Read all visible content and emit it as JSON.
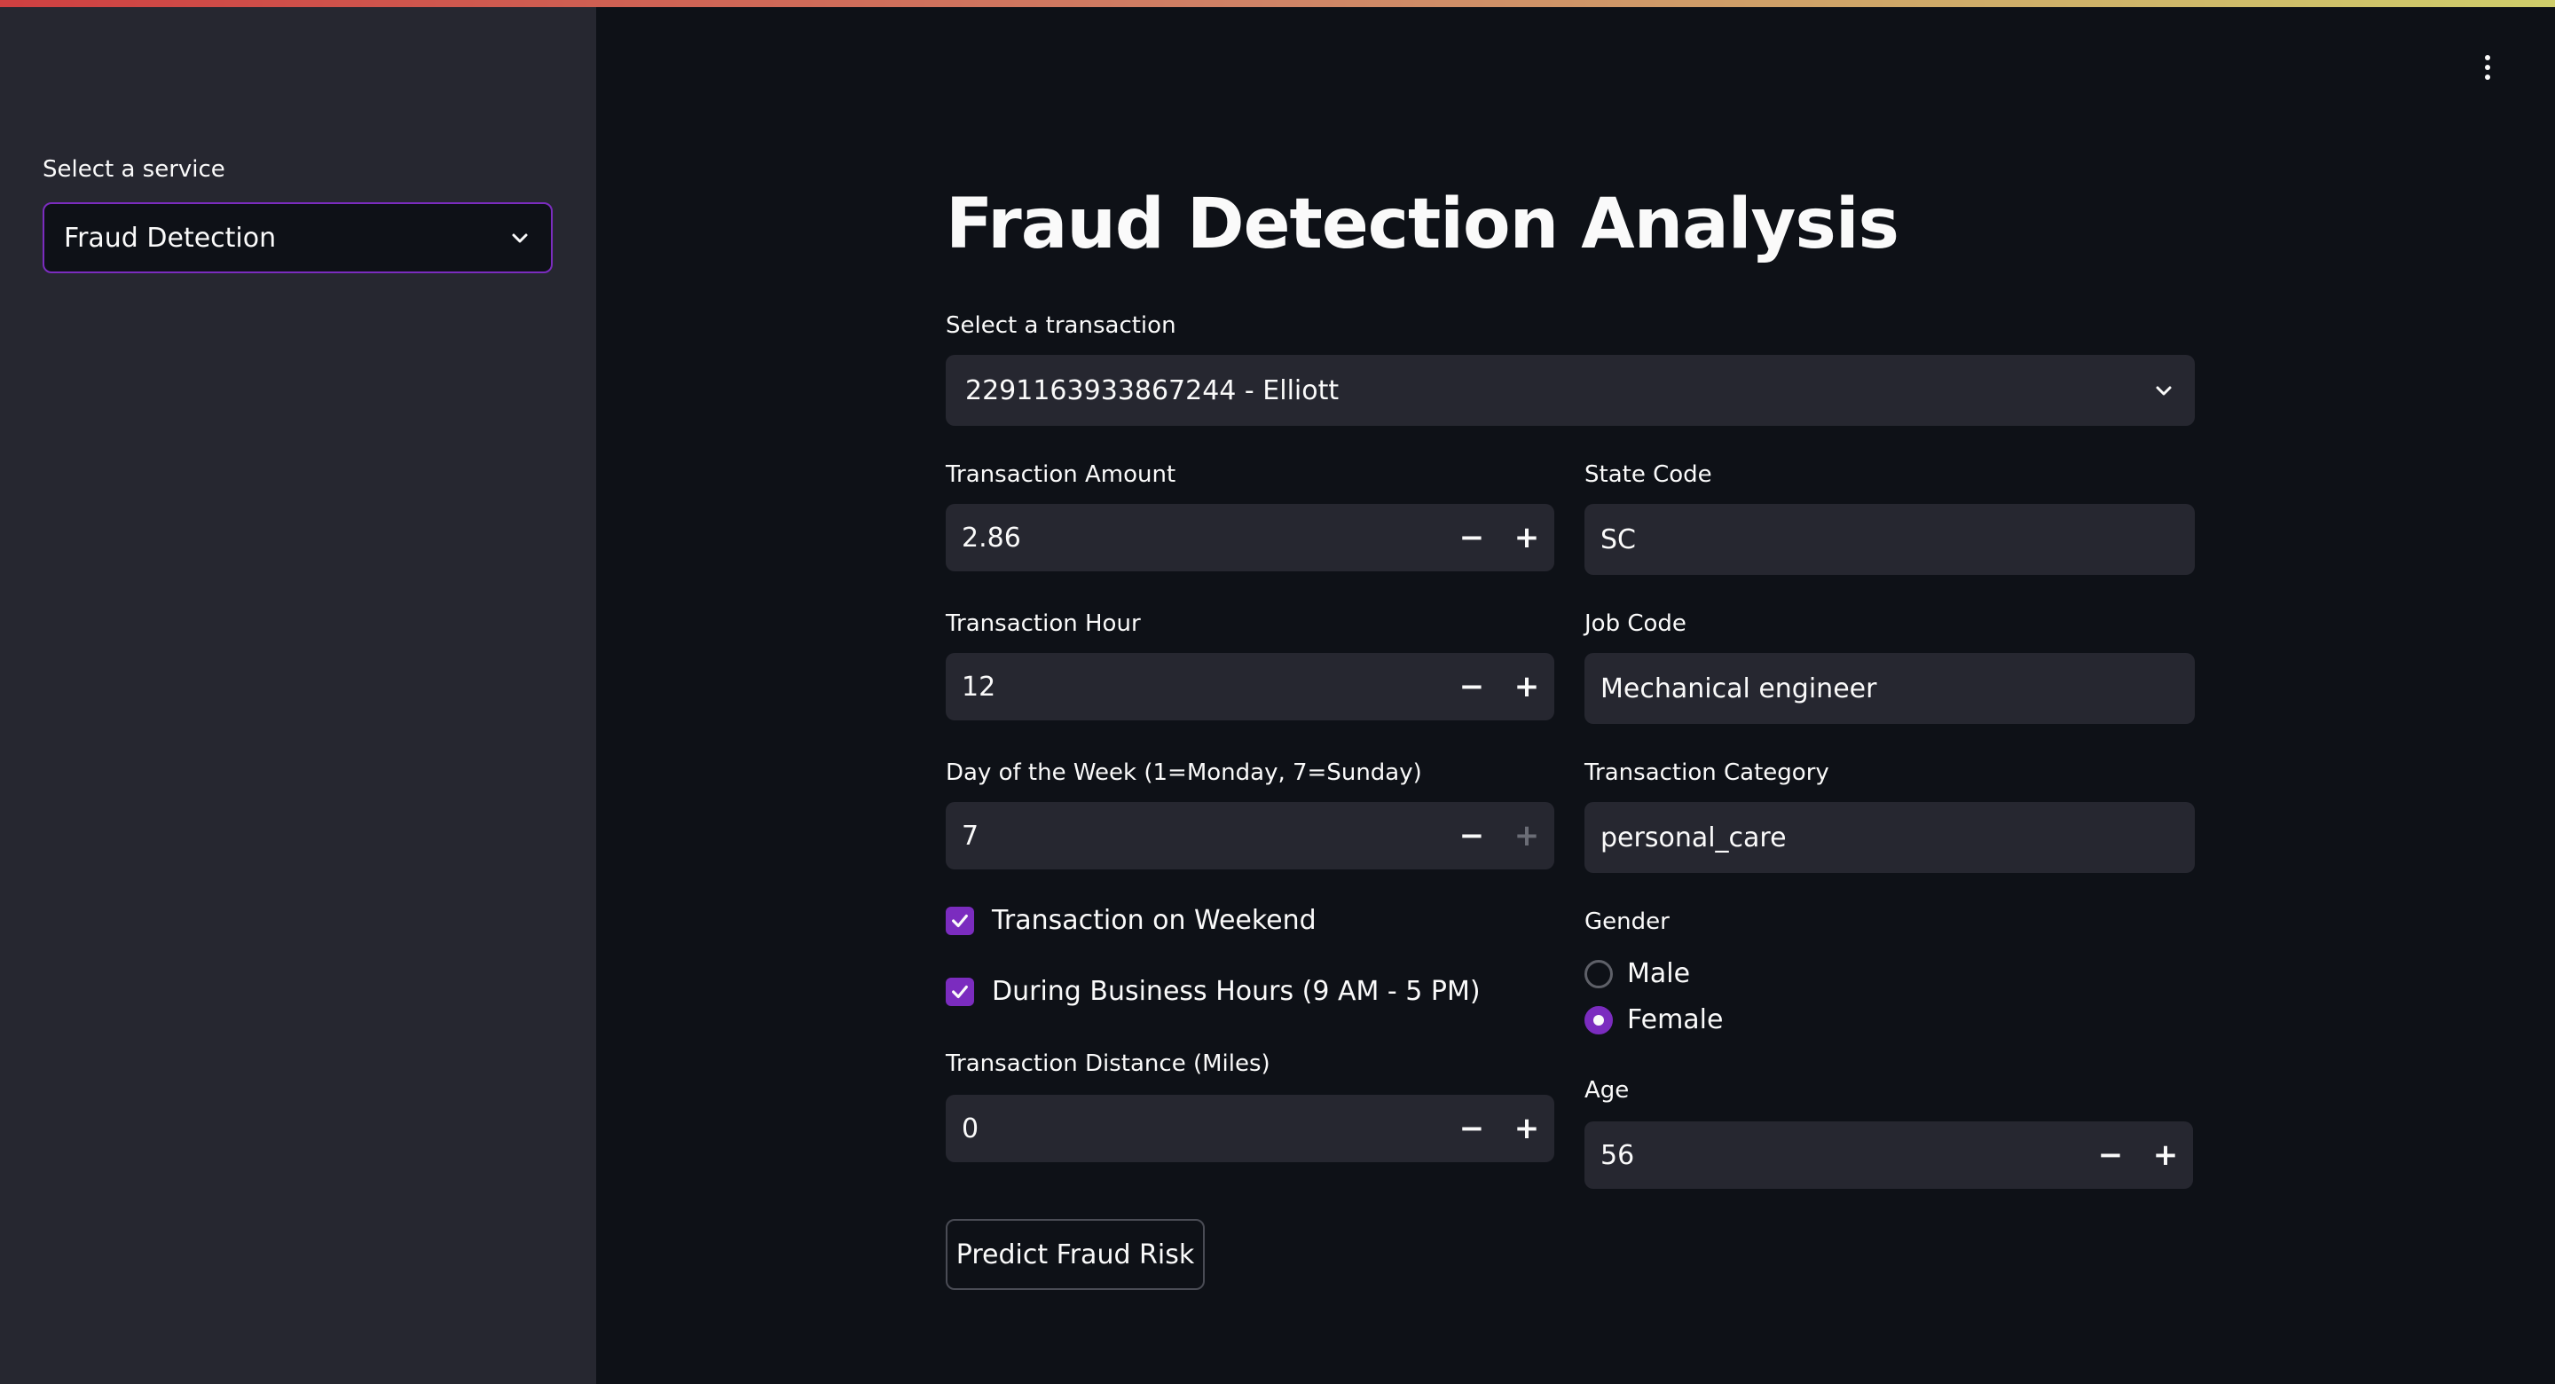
{
  "sidebar": {
    "label": "Select a service",
    "selected": "Fraud Detection"
  },
  "main": {
    "title": "Fraud Detection Analysis",
    "transaction_select": {
      "label": "Select a transaction",
      "value": "2291163933867244 - Elliott"
    },
    "amount": {
      "label": "Transaction Amount",
      "value": "2.86"
    },
    "state": {
      "label": "State Code",
      "value": "SC"
    },
    "hour": {
      "label": "Transaction Hour",
      "value": "12"
    },
    "job": {
      "label": "Job Code",
      "value": "Mechanical engineer"
    },
    "day": {
      "label": "Day of the Week (1=Monday, 7=Sunday)",
      "value": "7"
    },
    "category": {
      "label": "Transaction Category",
      "value": "personal_care"
    },
    "weekend": {
      "label": "Transaction on Weekend",
      "checked": true
    },
    "business_hours": {
      "label": "During Business Hours (9 AM - 5 PM)",
      "checked": true
    },
    "gender": {
      "label": "Gender",
      "options": [
        "Male",
        "Female"
      ],
      "selected": "Female"
    },
    "distance": {
      "label": "Transaction Distance (Miles)",
      "value": "0"
    },
    "age": {
      "label": "Age",
      "value": "56"
    },
    "predict_button": "Predict Fraud Risk"
  },
  "stepper": {
    "minus": "−",
    "plus": "+"
  },
  "colors": {
    "accent": "#7b2cbf",
    "background": "#0e1117",
    "sidebar": "#262730",
    "input": "#262730"
  }
}
